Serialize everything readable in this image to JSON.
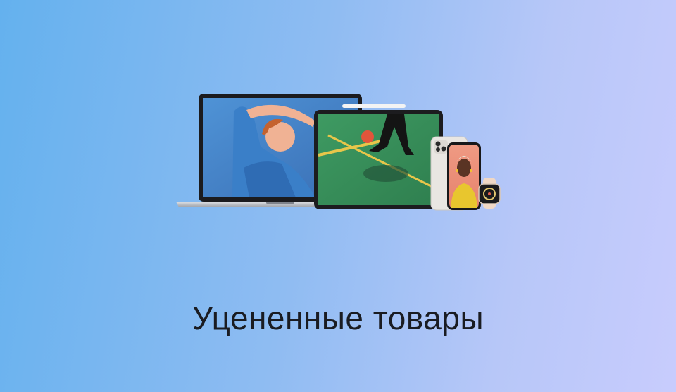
{
  "banner": {
    "title": "Уцененные товары",
    "background_colors": [
      "#64b1ee",
      "#c8ccfd"
    ]
  },
  "devices": {
    "items": [
      "laptop-icon",
      "tablet-icon",
      "phone-icon",
      "watch-icon"
    ]
  }
}
